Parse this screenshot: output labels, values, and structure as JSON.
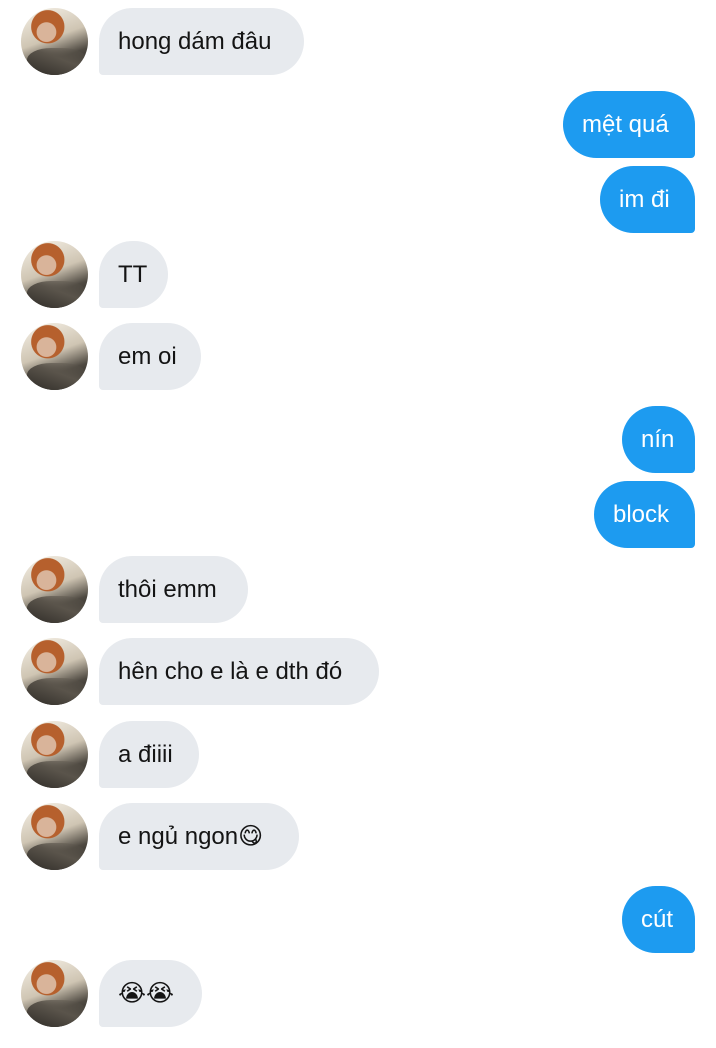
{
  "conversation": {
    "messages": [
      {
        "direction": "in",
        "text": "hong dám đâu"
      },
      {
        "direction": "out",
        "text": "mệt quá"
      },
      {
        "direction": "out",
        "text": "im đi"
      },
      {
        "direction": "in",
        "text": "TT"
      },
      {
        "direction": "in",
        "text": "em oi"
      },
      {
        "direction": "out",
        "text": "nín"
      },
      {
        "direction": "out",
        "text": "block"
      },
      {
        "direction": "in",
        "text": "thôi emm"
      },
      {
        "direction": "in",
        "text": "hên cho e là e dth đó"
      },
      {
        "direction": "in",
        "text": "a điiii"
      },
      {
        "direction": "in",
        "text": "e ngủ ngon😋"
      },
      {
        "direction": "out",
        "text": "cút"
      },
      {
        "direction": "in",
        "text": "😭😭"
      }
    ]
  },
  "colors": {
    "incoming_bubble": "#e7eaee",
    "outgoing_bubble": "#1d9bf0",
    "incoming_text": "#141414",
    "outgoing_text": "#ffffff",
    "background": "#ffffff"
  }
}
